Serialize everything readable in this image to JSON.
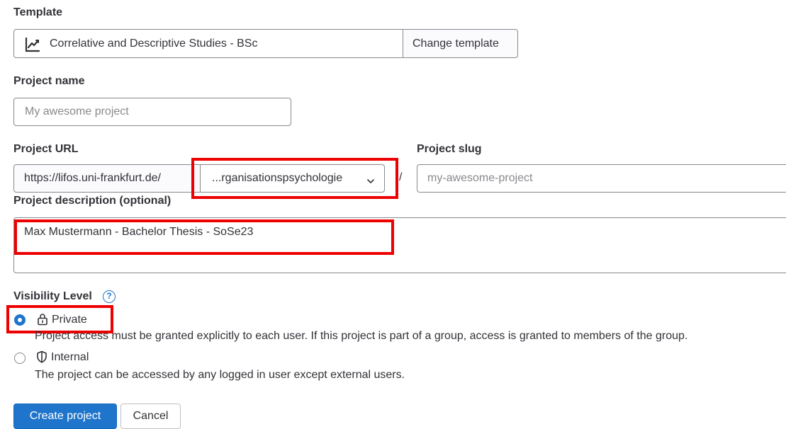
{
  "template": {
    "label": "Template",
    "selected": "Correlative and Descriptive Studies - BSc",
    "change_button": "Change template"
  },
  "project_name": {
    "label": "Project name",
    "placeholder": "My awesome project"
  },
  "project_url": {
    "label": "Project URL",
    "prefix": "https://lifos.uni-frankfurt.de/",
    "namespace": "...rganisationspsychologie",
    "separator": "/"
  },
  "project_slug": {
    "label": "Project slug",
    "placeholder": "my-awesome-project"
  },
  "description": {
    "label": "Project description (optional)",
    "value": "Max Mustermann - Bachelor Thesis - SoSe23"
  },
  "visibility": {
    "label": "Visibility Level",
    "help_icon": "?",
    "options": [
      {
        "icon": "lock-icon",
        "label": "Private",
        "description": "Project access must be granted explicitly to each user. If this project is part of a group, access is granted to members of the group."
      },
      {
        "icon": "shield-icon",
        "label": "Internal",
        "description": "The project can be accessed by any logged in user except external users."
      }
    ],
    "selected": "Private"
  },
  "actions": {
    "create": "Create project",
    "cancel": "Cancel"
  },
  "colors": {
    "primary": "#1f75cb",
    "highlight": "#ee0000",
    "border": "#89888d",
    "text": "#333238"
  }
}
